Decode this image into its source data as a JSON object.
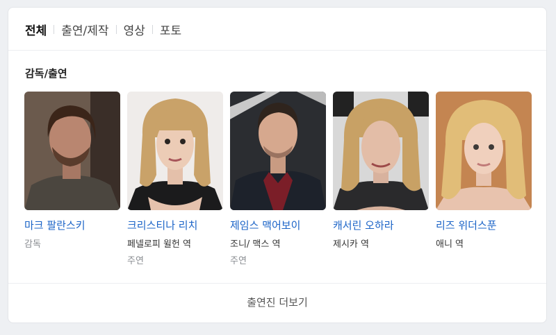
{
  "tabs": [
    {
      "label": "전체",
      "active": true
    },
    {
      "label": "출연/제작",
      "active": false
    },
    {
      "label": "영상",
      "active": false
    },
    {
      "label": "포토",
      "active": false
    }
  ],
  "section_title": "감독/출연",
  "people": [
    {
      "name": "마크 팔란스키",
      "role": "감독",
      "type": ""
    },
    {
      "name": "크리스티나 리치",
      "role": "페넬로피 윌헌 역",
      "type": "주연"
    },
    {
      "name": "제임스 맥어보이",
      "role": "조니/ 맥스 역",
      "type": "주연"
    },
    {
      "name": "캐서린 오하라",
      "role": "제시카 역",
      "type": ""
    },
    {
      "name": "리즈 위더스푼",
      "role": "애니 역",
      "type": ""
    }
  ],
  "more_label": "출연진 더보기",
  "colors": {
    "link": "#1a63c7",
    "muted": "#8a8d92"
  }
}
